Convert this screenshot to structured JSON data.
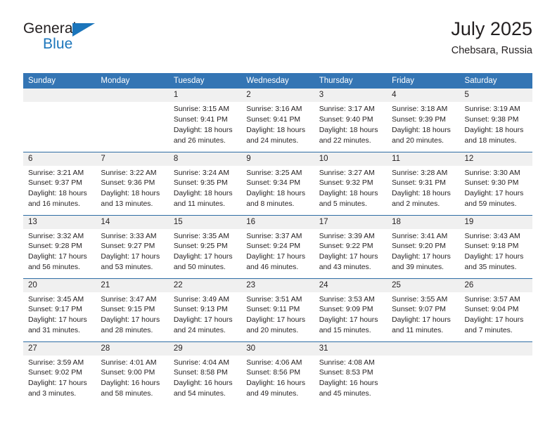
{
  "brand": {
    "name_top": "General",
    "name_bottom": "Blue",
    "accent_color": "#1b75bb"
  },
  "header": {
    "title": "July 2025",
    "subtitle": "Chebsara, Russia"
  },
  "theme": {
    "header_bg": "#3475b4",
    "daynum_bg": "#f0f0f0",
    "row_divider": "#2e6da4",
    "text": "#231f20"
  },
  "calendar": {
    "weekday_headers": [
      "Sunday",
      "Monday",
      "Tuesday",
      "Wednesday",
      "Thursday",
      "Friday",
      "Saturday"
    ],
    "weeks": [
      [
        {
          "day": "",
          "sunrise": "",
          "sunset": "",
          "daylight": "",
          "empty": true
        },
        {
          "day": "",
          "sunrise": "",
          "sunset": "",
          "daylight": "",
          "empty": true
        },
        {
          "day": "1",
          "sunrise": "Sunrise: 3:15 AM",
          "sunset": "Sunset: 9:41 PM",
          "daylight": "Daylight: 18 hours and 26 minutes."
        },
        {
          "day": "2",
          "sunrise": "Sunrise: 3:16 AM",
          "sunset": "Sunset: 9:41 PM",
          "daylight": "Daylight: 18 hours and 24 minutes."
        },
        {
          "day": "3",
          "sunrise": "Sunrise: 3:17 AM",
          "sunset": "Sunset: 9:40 PM",
          "daylight": "Daylight: 18 hours and 22 minutes."
        },
        {
          "day": "4",
          "sunrise": "Sunrise: 3:18 AM",
          "sunset": "Sunset: 9:39 PM",
          "daylight": "Daylight: 18 hours and 20 minutes."
        },
        {
          "day": "5",
          "sunrise": "Sunrise: 3:19 AM",
          "sunset": "Sunset: 9:38 PM",
          "daylight": "Daylight: 18 hours and 18 minutes."
        }
      ],
      [
        {
          "day": "6",
          "sunrise": "Sunrise: 3:21 AM",
          "sunset": "Sunset: 9:37 PM",
          "daylight": "Daylight: 18 hours and 16 minutes."
        },
        {
          "day": "7",
          "sunrise": "Sunrise: 3:22 AM",
          "sunset": "Sunset: 9:36 PM",
          "daylight": "Daylight: 18 hours and 13 minutes."
        },
        {
          "day": "8",
          "sunrise": "Sunrise: 3:24 AM",
          "sunset": "Sunset: 9:35 PM",
          "daylight": "Daylight: 18 hours and 11 minutes."
        },
        {
          "day": "9",
          "sunrise": "Sunrise: 3:25 AM",
          "sunset": "Sunset: 9:34 PM",
          "daylight": "Daylight: 18 hours and 8 minutes."
        },
        {
          "day": "10",
          "sunrise": "Sunrise: 3:27 AM",
          "sunset": "Sunset: 9:32 PM",
          "daylight": "Daylight: 18 hours and 5 minutes."
        },
        {
          "day": "11",
          "sunrise": "Sunrise: 3:28 AM",
          "sunset": "Sunset: 9:31 PM",
          "daylight": "Daylight: 18 hours and 2 minutes."
        },
        {
          "day": "12",
          "sunrise": "Sunrise: 3:30 AM",
          "sunset": "Sunset: 9:30 PM",
          "daylight": "Daylight: 17 hours and 59 minutes."
        }
      ],
      [
        {
          "day": "13",
          "sunrise": "Sunrise: 3:32 AM",
          "sunset": "Sunset: 9:28 PM",
          "daylight": "Daylight: 17 hours and 56 minutes."
        },
        {
          "day": "14",
          "sunrise": "Sunrise: 3:33 AM",
          "sunset": "Sunset: 9:27 PM",
          "daylight": "Daylight: 17 hours and 53 minutes."
        },
        {
          "day": "15",
          "sunrise": "Sunrise: 3:35 AM",
          "sunset": "Sunset: 9:25 PM",
          "daylight": "Daylight: 17 hours and 50 minutes."
        },
        {
          "day": "16",
          "sunrise": "Sunrise: 3:37 AM",
          "sunset": "Sunset: 9:24 PM",
          "daylight": "Daylight: 17 hours and 46 minutes."
        },
        {
          "day": "17",
          "sunrise": "Sunrise: 3:39 AM",
          "sunset": "Sunset: 9:22 PM",
          "daylight": "Daylight: 17 hours and 43 minutes."
        },
        {
          "day": "18",
          "sunrise": "Sunrise: 3:41 AM",
          "sunset": "Sunset: 9:20 PM",
          "daylight": "Daylight: 17 hours and 39 minutes."
        },
        {
          "day": "19",
          "sunrise": "Sunrise: 3:43 AM",
          "sunset": "Sunset: 9:18 PM",
          "daylight": "Daylight: 17 hours and 35 minutes."
        }
      ],
      [
        {
          "day": "20",
          "sunrise": "Sunrise: 3:45 AM",
          "sunset": "Sunset: 9:17 PM",
          "daylight": "Daylight: 17 hours and 31 minutes."
        },
        {
          "day": "21",
          "sunrise": "Sunrise: 3:47 AM",
          "sunset": "Sunset: 9:15 PM",
          "daylight": "Daylight: 17 hours and 28 minutes."
        },
        {
          "day": "22",
          "sunrise": "Sunrise: 3:49 AM",
          "sunset": "Sunset: 9:13 PM",
          "daylight": "Daylight: 17 hours and 24 minutes."
        },
        {
          "day": "23",
          "sunrise": "Sunrise: 3:51 AM",
          "sunset": "Sunset: 9:11 PM",
          "daylight": "Daylight: 17 hours and 20 minutes."
        },
        {
          "day": "24",
          "sunrise": "Sunrise: 3:53 AM",
          "sunset": "Sunset: 9:09 PM",
          "daylight": "Daylight: 17 hours and 15 minutes."
        },
        {
          "day": "25",
          "sunrise": "Sunrise: 3:55 AM",
          "sunset": "Sunset: 9:07 PM",
          "daylight": "Daylight: 17 hours and 11 minutes."
        },
        {
          "day": "26",
          "sunrise": "Sunrise: 3:57 AM",
          "sunset": "Sunset: 9:04 PM",
          "daylight": "Daylight: 17 hours and 7 minutes."
        }
      ],
      [
        {
          "day": "27",
          "sunrise": "Sunrise: 3:59 AM",
          "sunset": "Sunset: 9:02 PM",
          "daylight": "Daylight: 17 hours and 3 minutes."
        },
        {
          "day": "28",
          "sunrise": "Sunrise: 4:01 AM",
          "sunset": "Sunset: 9:00 PM",
          "daylight": "Daylight: 16 hours and 58 minutes."
        },
        {
          "day": "29",
          "sunrise": "Sunrise: 4:04 AM",
          "sunset": "Sunset: 8:58 PM",
          "daylight": "Daylight: 16 hours and 54 minutes."
        },
        {
          "day": "30",
          "sunrise": "Sunrise: 4:06 AM",
          "sunset": "Sunset: 8:56 PM",
          "daylight": "Daylight: 16 hours and 49 minutes."
        },
        {
          "day": "31",
          "sunrise": "Sunrise: 4:08 AM",
          "sunset": "Sunset: 8:53 PM",
          "daylight": "Daylight: 16 hours and 45 minutes."
        },
        {
          "day": "",
          "sunrise": "",
          "sunset": "",
          "daylight": "",
          "empty": true
        },
        {
          "day": "",
          "sunrise": "",
          "sunset": "",
          "daylight": "",
          "empty": true
        }
      ]
    ]
  }
}
